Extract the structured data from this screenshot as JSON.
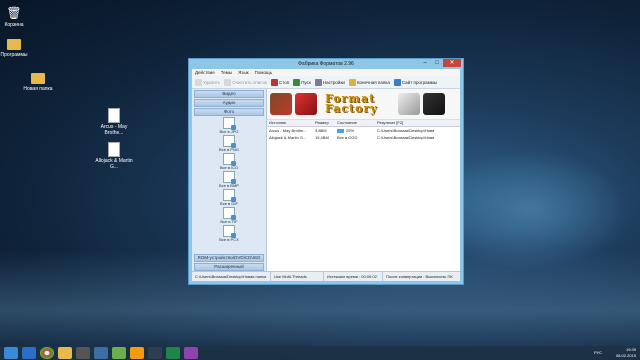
{
  "desktop": {
    "icons": [
      {
        "label": "Корзина",
        "icon": "recycle-bin-icon"
      },
      {
        "label": "Программы",
        "icon": "folder-icon"
      },
      {
        "label": "Новая папка",
        "icon": "folder-icon"
      },
      {
        "label": "Arcus - May Brothe...",
        "icon": "audio-file-icon"
      },
      {
        "label": "Allojack & Martin G...",
        "icon": "audio-file-icon"
      }
    ]
  },
  "window": {
    "title": "Фабрика Форматов 2.96",
    "menu": [
      "Действие",
      "Темы",
      "Язык",
      "Помощь"
    ],
    "toolbar": [
      {
        "label": "Удалить",
        "enabled": false
      },
      {
        "label": "Очистить список",
        "enabled": false
      },
      {
        "label": "Стоп",
        "enabled": true
      },
      {
        "label": "Пуск",
        "enabled": true
      },
      {
        "label": "Настройки",
        "enabled": true
      },
      {
        "label": "Конечная папка",
        "enabled": true
      },
      {
        "label": "Сайт программы",
        "enabled": true
      }
    ],
    "categories": {
      "video": "Видео",
      "audio": "Аудио",
      "photo": "Фото",
      "rom": "ROM-устройство\\DVD\\CD\\ISO",
      "advanced": "Расширенный"
    },
    "formats": [
      "Все в JPG",
      "Все в PNG",
      "Все в ICO",
      "Все в BMP",
      "Все в GIF",
      "Все в TIF",
      "Все в PCX"
    ],
    "logo": [
      "Format",
      "Factory"
    ],
    "table": {
      "headers": [
        "Источник",
        "Размер",
        "Состояние",
        "Результат [F2]"
      ],
      "rows": [
        {
          "source": "Arcus - May Brothe...",
          "size": "3,8BM",
          "progress": 25,
          "state": "25%",
          "result": "C:\\Users\\Вильма\\Desktop\\Нова"
        },
        {
          "source": "Allojack & Martin G...",
          "size": "15,4BM",
          "progress": 0,
          "state": "Все в OGG",
          "result": "C:\\Users\\Вильма\\Desktop\\Нова"
        }
      ]
    },
    "status": {
      "path": "C:\\Users\\Вильма\\Desktop\\Новая папка",
      "threads": "Use Multi-Threads",
      "elapsed": "Истекшее время : 00:00:02",
      "after": "После конвертации : Выключить ПК"
    }
  },
  "taskbar": {
    "lang": "РУС",
    "time": "19:39",
    "date": "08.02.2015"
  }
}
